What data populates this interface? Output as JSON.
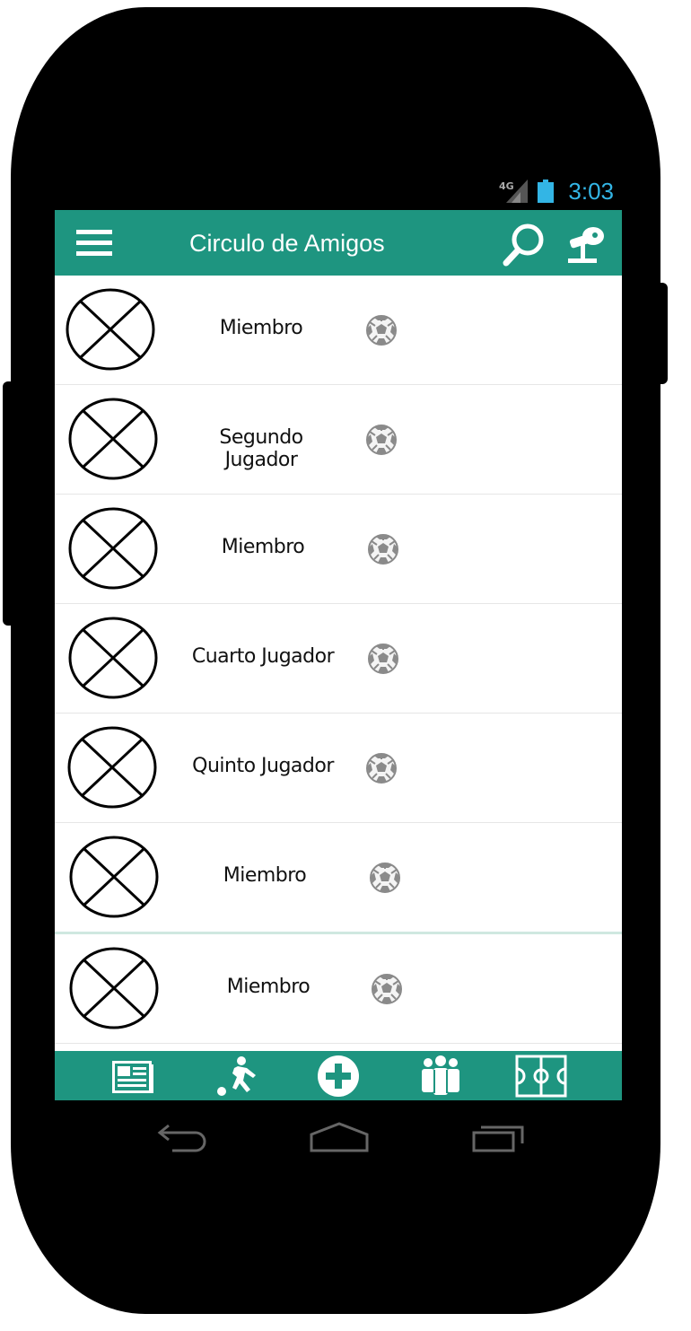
{
  "status_bar": {
    "time": "3:03",
    "network": "4G"
  },
  "app_bar": {
    "title": "Circulo de Amigos",
    "menu_icon": "hamburger-menu-icon",
    "search_icon": "search-icon",
    "whistle_icon": "whistle-icon"
  },
  "members": [
    {
      "name": "Miembro"
    },
    {
      "name": "Segundo Jugador"
    },
    {
      "name": "Miembro"
    },
    {
      "name": "Cuarto Jugador"
    },
    {
      "name": "Quinto Jugador"
    },
    {
      "name": "Miembro"
    },
    {
      "name": "Miembro"
    }
  ],
  "bottom_nav": [
    {
      "icon": "news-icon"
    },
    {
      "icon": "player-kicking-icon"
    },
    {
      "icon": "add-circle-icon"
    },
    {
      "icon": "team-icon"
    },
    {
      "icon": "soccer-field-icon"
    }
  ],
  "colors": {
    "primary": "#1e9580",
    "status_time": "#33b5e5",
    "divider_accent": "#cfe8e0"
  }
}
